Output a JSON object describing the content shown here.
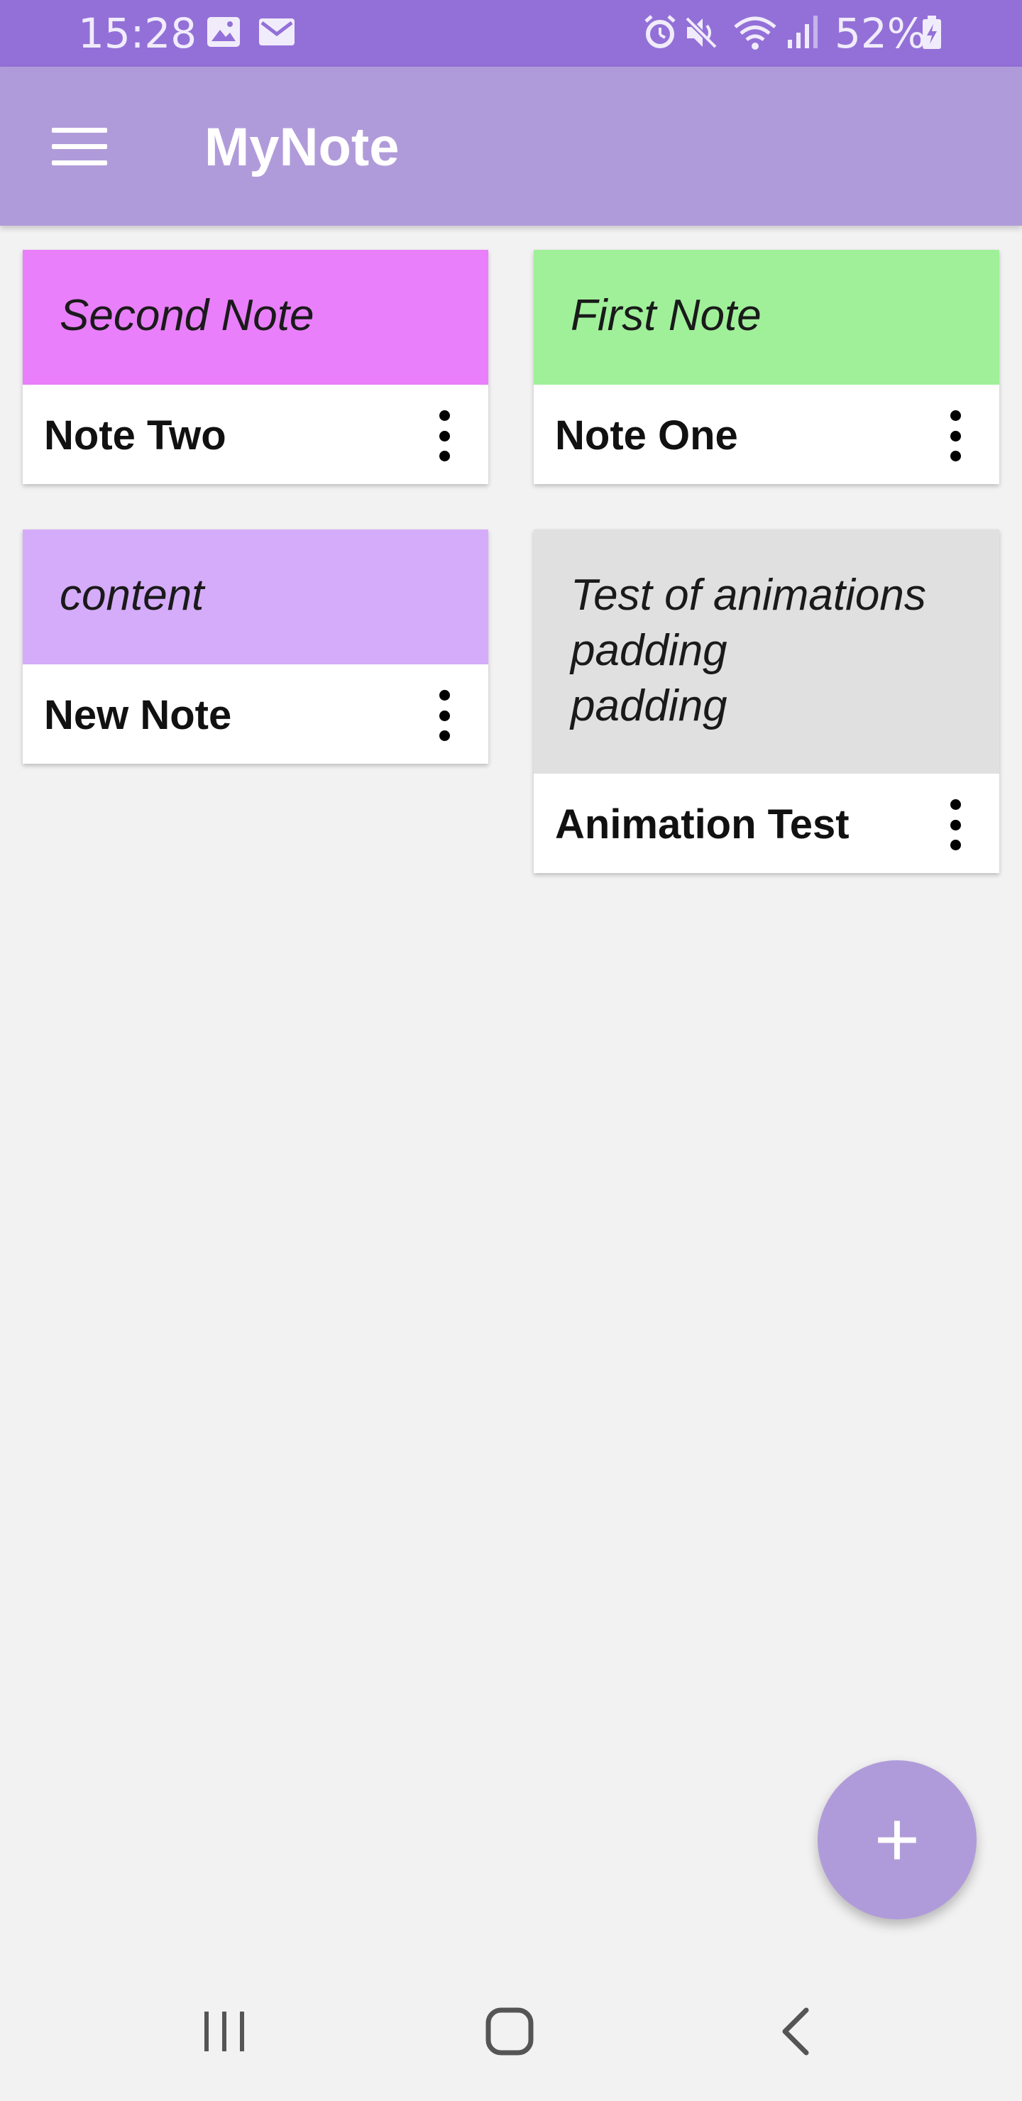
{
  "status_bar": {
    "time": "15:28",
    "battery_percent": "52%",
    "icons": [
      "image-icon",
      "mail-icon",
      "alarm-icon",
      "mute-icon",
      "wifi-icon",
      "signal-icon",
      "battery-charging-icon"
    ],
    "bg_color": "#9370d8"
  },
  "app_bar": {
    "title": "MyNote",
    "menu_icon": "hamburger-menu-icon",
    "bg_color": "#b09bda"
  },
  "notes": [
    {
      "title": "Note Two",
      "content": "Second Note",
      "color": "#e97ffa"
    },
    {
      "title": "Note One",
      "content": "First Note",
      "color": "#a0f09a"
    },
    {
      "title": "New Note",
      "content": "content",
      "color": "#d5acfa"
    },
    {
      "title": "Animation Test",
      "content": "Test of animations\npadding\npadding",
      "color": "#e0e0e0"
    }
  ],
  "fab": {
    "label": "+",
    "icon": "add-icon",
    "color": "#b09bda"
  },
  "nav_bar": {
    "items": [
      "recent-apps-icon",
      "home-icon",
      "back-icon"
    ]
  }
}
